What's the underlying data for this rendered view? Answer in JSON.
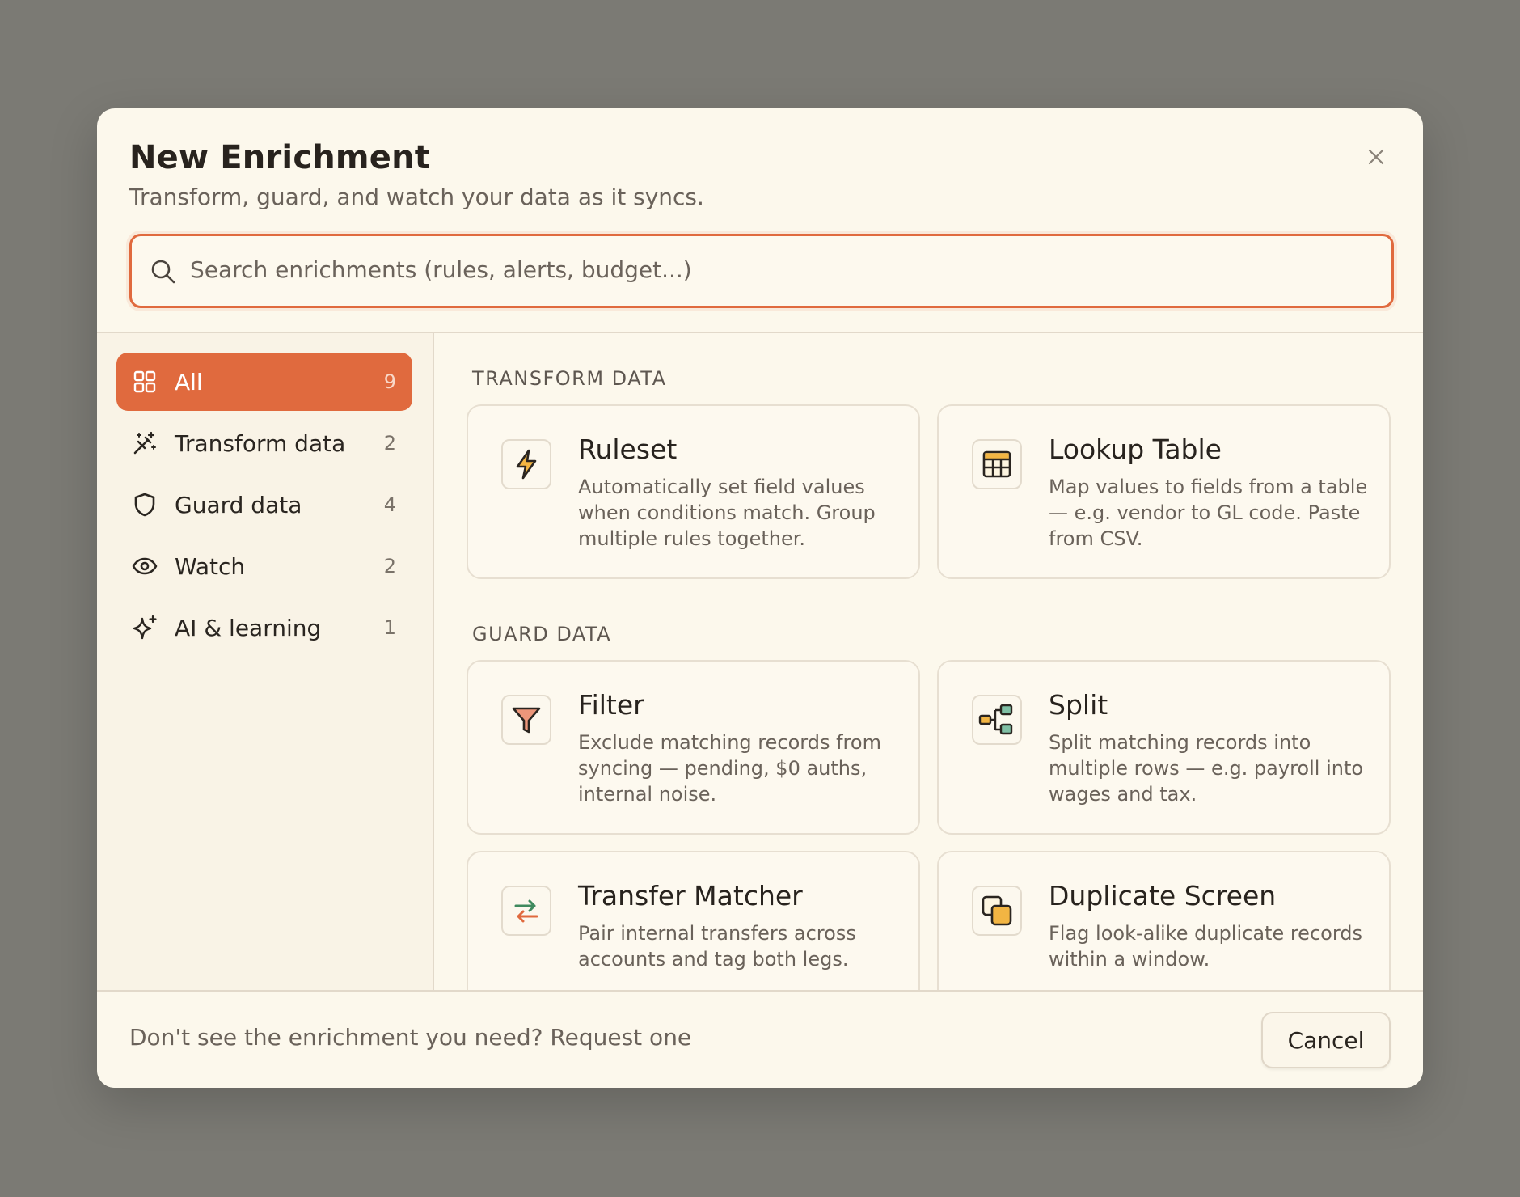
{
  "dialog": {
    "title": "New Enrichment",
    "subtitle": "Transform, guard, and watch your data as it syncs.",
    "close_icon": "close-icon"
  },
  "search": {
    "placeholder": "Search enrichments (rules, alerts, budget...)",
    "value": ""
  },
  "sidebar": {
    "items": [
      {
        "label": "All",
        "count": "9",
        "icon": "grid-icon",
        "active": true
      },
      {
        "label": "Transform data",
        "count": "2",
        "icon": "magic-wand-icon"
      },
      {
        "label": "Guard data",
        "count": "4",
        "icon": "shield-icon"
      },
      {
        "label": "Watch",
        "count": "2",
        "icon": "eye-icon"
      },
      {
        "label": "AI & learning",
        "count": "1",
        "icon": "sparkle-icon"
      }
    ]
  },
  "sections": [
    {
      "label": "TRANSFORM DATA",
      "cards": [
        {
          "title": "Ruleset",
          "desc": "Automatically set field values when conditions match. Group multiple rules together.",
          "icon": "lightning-icon"
        },
        {
          "title": "Lookup Table",
          "desc": "Map values to fields from a table — e.g. vendor to GL code. Paste from CSV.",
          "icon": "table-icon"
        }
      ]
    },
    {
      "label": "GUARD DATA",
      "cards": [
        {
          "title": "Filter",
          "desc": "Exclude matching records from syncing — pending, $0 auths, internal noise.",
          "icon": "funnel-icon"
        },
        {
          "title": "Split",
          "desc": "Split matching records into multiple rows — e.g. payroll into wages and tax.",
          "icon": "split-icon"
        },
        {
          "title": "Transfer Matcher",
          "desc": "Pair internal transfers across accounts and tag both legs.",
          "icon": "transfer-arrows-icon"
        },
        {
          "title": "Duplicate Screen",
          "desc": "Flag look-alike duplicate records within a window.",
          "icon": "duplicate-icon"
        }
      ]
    }
  ],
  "footer": {
    "text": "Don't see the enrichment you need? Request one",
    "cancel_label": "Cancel"
  },
  "colors": {
    "accent": "#e06a3e",
    "backdrop": "#7b7a74",
    "surface": "#fcf8ec"
  }
}
